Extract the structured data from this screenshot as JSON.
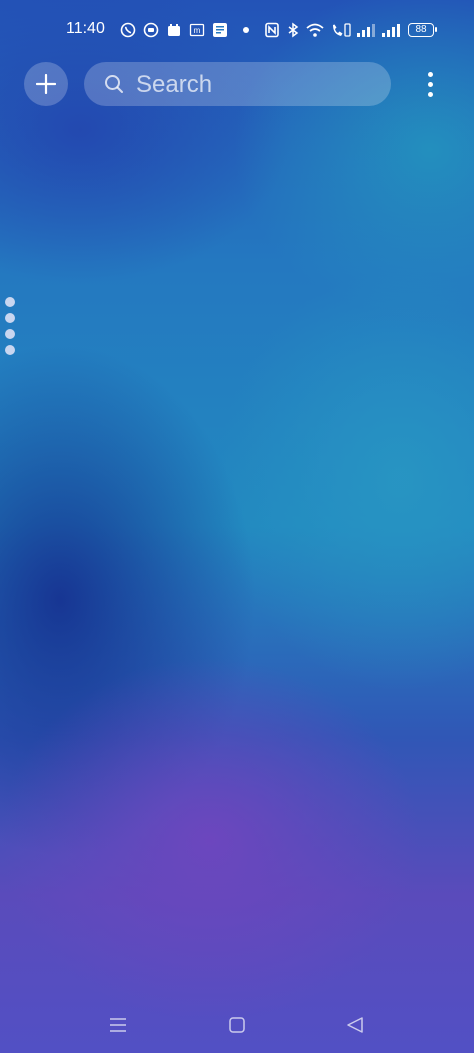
{
  "status_bar": {
    "time": "11:40",
    "icons": [
      "whatsapp-icon",
      "chat-icon",
      "calendar-icon",
      "m-app-icon",
      "notes-icon",
      "dot-icon",
      "nfc-icon",
      "bluetooth-icon",
      "wifi-icon",
      "volte-icon",
      "signal-icon",
      "signal-icon-2"
    ],
    "battery": "88"
  },
  "toolbar": {
    "add_icon": "plus-icon",
    "search_placeholder": "Search",
    "menu_icon": "more-vertical-icon"
  },
  "page_indicator": {
    "pages": 4
  },
  "nav_bar": {
    "buttons": [
      "menu-icon",
      "home-icon",
      "back-icon"
    ]
  },
  "colors": {
    "accent": "#ffffff",
    "bg_top": "#2353b7",
    "bg_mid": "#2289c0",
    "bg_bottom": "#5a4bbb"
  }
}
